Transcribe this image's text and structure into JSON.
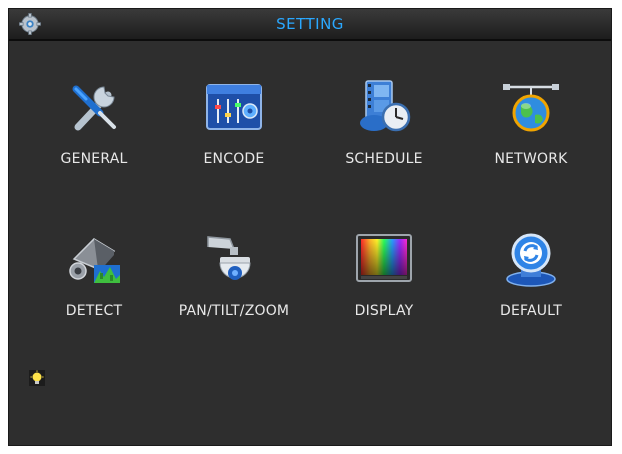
{
  "header": {
    "title": "SETTING",
    "icon": "gear-icon"
  },
  "menu": {
    "items": [
      {
        "label": "GENERAL",
        "icon": "tools-icon"
      },
      {
        "label": "ENCODE",
        "icon": "encode-mixer-icon"
      },
      {
        "label": "SCHEDULE",
        "icon": "schedule-clock-icon"
      },
      {
        "label": "NETWORK",
        "icon": "network-globe-icon"
      },
      {
        "label": "DETECT",
        "icon": "motion-detect-camera-icon"
      },
      {
        "label": "PAN/TILT/ZOOM",
        "icon": "ptz-dome-camera-icon"
      },
      {
        "label": "DISPLAY",
        "icon": "display-monitor-icon"
      },
      {
        "label": "DEFAULT",
        "icon": "restore-default-icon"
      }
    ]
  },
  "footer": {
    "icon": "tip-lightbulb-icon"
  },
  "colors": {
    "background": "#2e2e2e",
    "title": "#2aa8ff",
    "label": "#e8e8e8"
  }
}
